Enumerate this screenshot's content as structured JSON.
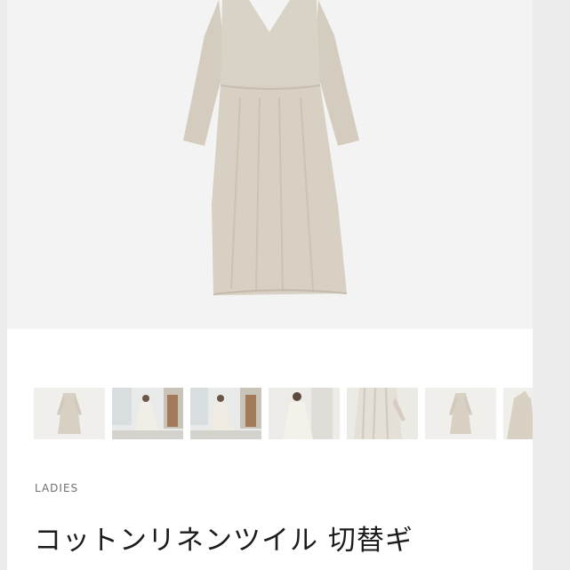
{
  "product": {
    "category": "LADIES",
    "title": "コットンリネンツイル 切替ギ"
  },
  "gallery": {
    "thumbnail_count": 7
  },
  "colors": {
    "fabric": "#d6cfc2",
    "background": "#f3f3f3"
  }
}
